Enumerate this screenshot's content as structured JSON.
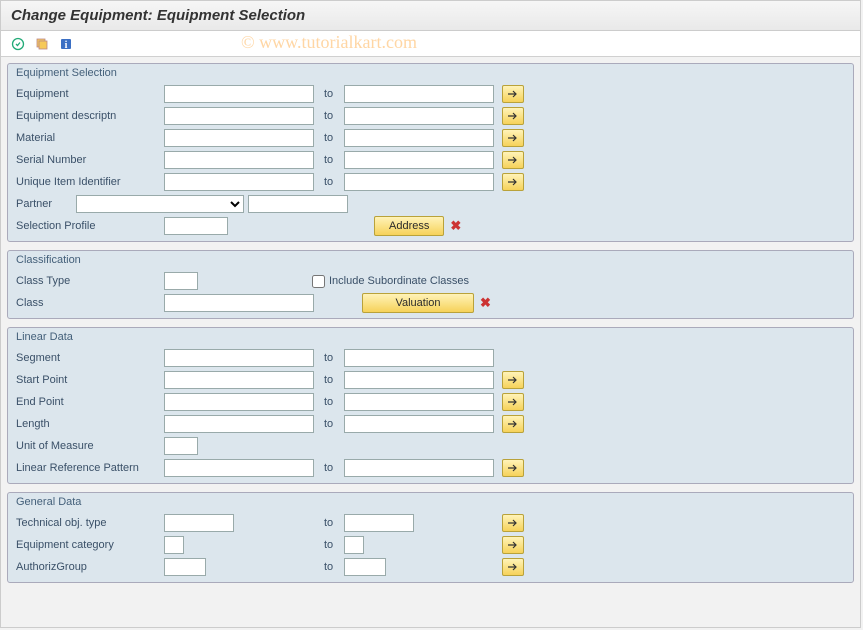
{
  "title": "Change Equipment: Equipment Selection",
  "watermark": "© www.tutorialkart.com",
  "groups": {
    "equipment_selection": {
      "title": "Equipment Selection",
      "rows": {
        "equipment": {
          "label": "Equipment",
          "to": "to"
        },
        "equipment_descriptn": {
          "label": "Equipment descriptn",
          "to": "to"
        },
        "material": {
          "label": "Material",
          "to": "to"
        },
        "serial_number": {
          "label": "Serial Number",
          "to": "to"
        },
        "unique_item_identifier": {
          "label": "Unique Item Identifier",
          "to": "to"
        },
        "partner": {
          "label": "Partner"
        },
        "selection_profile": {
          "label": "Selection Profile"
        }
      },
      "address_btn": "Address"
    },
    "classification": {
      "title": "Classification",
      "rows": {
        "class_type": {
          "label": "Class Type"
        },
        "include_sub": {
          "label": "Include Subordinate Classes"
        },
        "class": {
          "label": "Class"
        }
      },
      "valuation_btn": "Valuation"
    },
    "linear_data": {
      "title": "Linear Data",
      "rows": {
        "segment": {
          "label": "Segment",
          "to": "to"
        },
        "start_point": {
          "label": "Start Point",
          "to": "to"
        },
        "end_point": {
          "label": "End Point",
          "to": "to"
        },
        "length": {
          "label": "Length",
          "to": "to"
        },
        "unit_of_measure": {
          "label": "Unit of Measure"
        },
        "linear_ref_pattern": {
          "label": "Linear Reference Pattern",
          "to": "to"
        }
      }
    },
    "general_data": {
      "title": "General Data",
      "rows": {
        "technical_obj_type": {
          "label": "Technical obj. type",
          "to": "to"
        },
        "equipment_category": {
          "label": "Equipment category",
          "to": "to"
        },
        "authoriz_group": {
          "label": "AuthorizGroup",
          "to": "to"
        }
      }
    }
  }
}
